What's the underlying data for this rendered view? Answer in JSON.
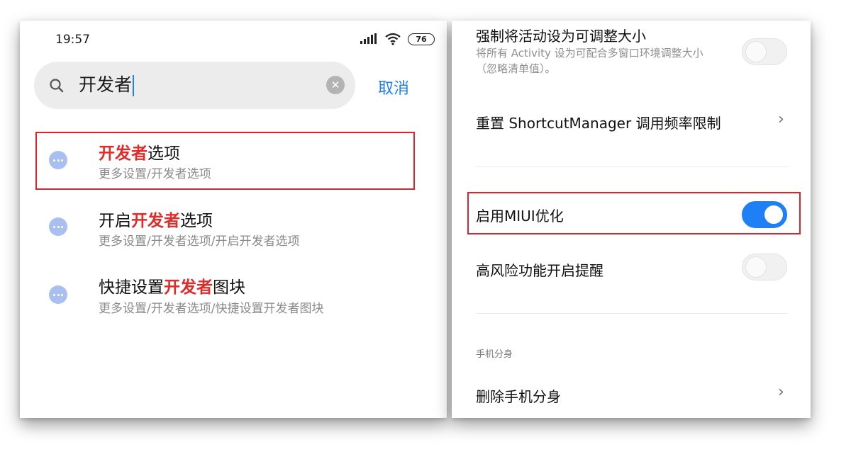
{
  "left": {
    "status": {
      "time": "19:57",
      "battery": "76"
    },
    "search": {
      "query": "开发者",
      "cancel": "取消"
    },
    "results": [
      {
        "title_pre": "",
        "title_hl": "开发者",
        "title_post": "选项",
        "subtitle": "更多设置/开发者选项"
      },
      {
        "title_pre": "开启",
        "title_hl": "开发者",
        "title_post": "选项",
        "subtitle": "更多设置/开发者选项/开启开发者选项"
      },
      {
        "title_pre": "快捷设置",
        "title_hl": "开发者",
        "title_post": "图块",
        "subtitle": "更多设置/开发者选项/快捷设置开发者图块"
      }
    ]
  },
  "right": {
    "resizable": {
      "title": "强制将活动设为可调整大小",
      "desc": "将所有 Activity 设为可配合多窗口环境调整大小（忽略清单值）。",
      "enabled": false
    },
    "shortcut_reset": {
      "title": "重置 ShortcutManager 调用频率限制"
    },
    "miui_opt": {
      "title": "启用MIUI优化",
      "enabled": true
    },
    "risk_alert": {
      "title": "高风险功能开启提醒",
      "enabled": false
    },
    "section_dual": "手机分身",
    "delete_dual": {
      "title": "删除手机分身"
    }
  },
  "colors": {
    "accent": "#1f7ff5",
    "highlight": "#e02b2b",
    "frame": "#d8262e"
  }
}
